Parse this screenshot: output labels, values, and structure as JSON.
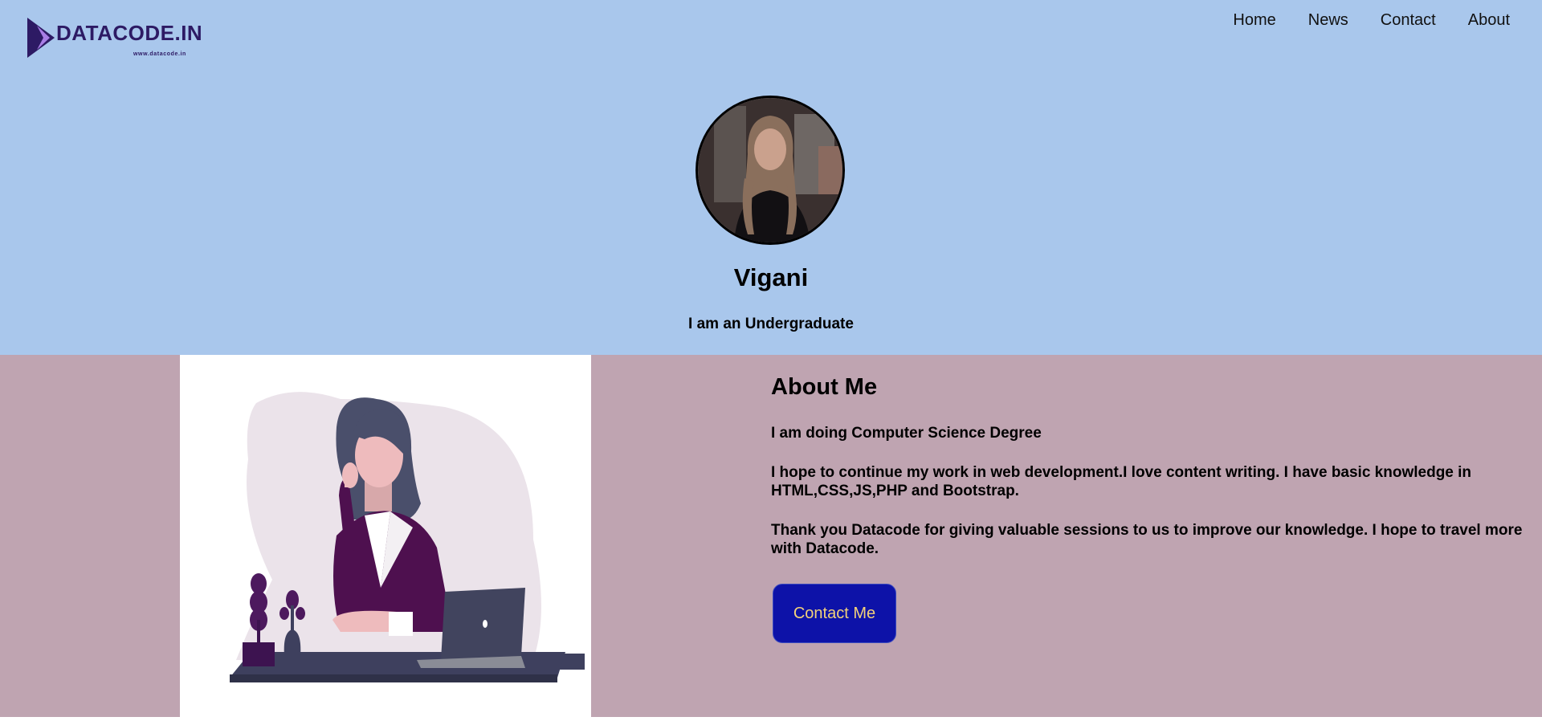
{
  "brand": {
    "name": "DATACODE.IN",
    "url": "www.datacode.in",
    "color": "#2d1a64",
    "accent": "#a97ee6"
  },
  "nav": {
    "items": [
      "Home",
      "News",
      "Contact",
      "About"
    ]
  },
  "profile": {
    "name": "Vigani",
    "tagline": "I am an Undergraduate"
  },
  "about": {
    "title": "About Me",
    "paragraphs": [
      "I am doing Computer Science Degree",
      "I hope to continue my work in web development.I love content writing. I have basic knowledge in HTML,CSS,JS,PHP and Bootstrap.",
      "Thank you Datacode for giving valuable sessions to us to improve our knowledge. I hope to travel more with Datacode."
    ],
    "button_label": "Contact Me"
  },
  "colors": {
    "hero_bg": "#a9c7ec",
    "about_bg": "#bfa4b1",
    "button_bg": "#0d12a8",
    "button_text": "#f3d27a"
  }
}
